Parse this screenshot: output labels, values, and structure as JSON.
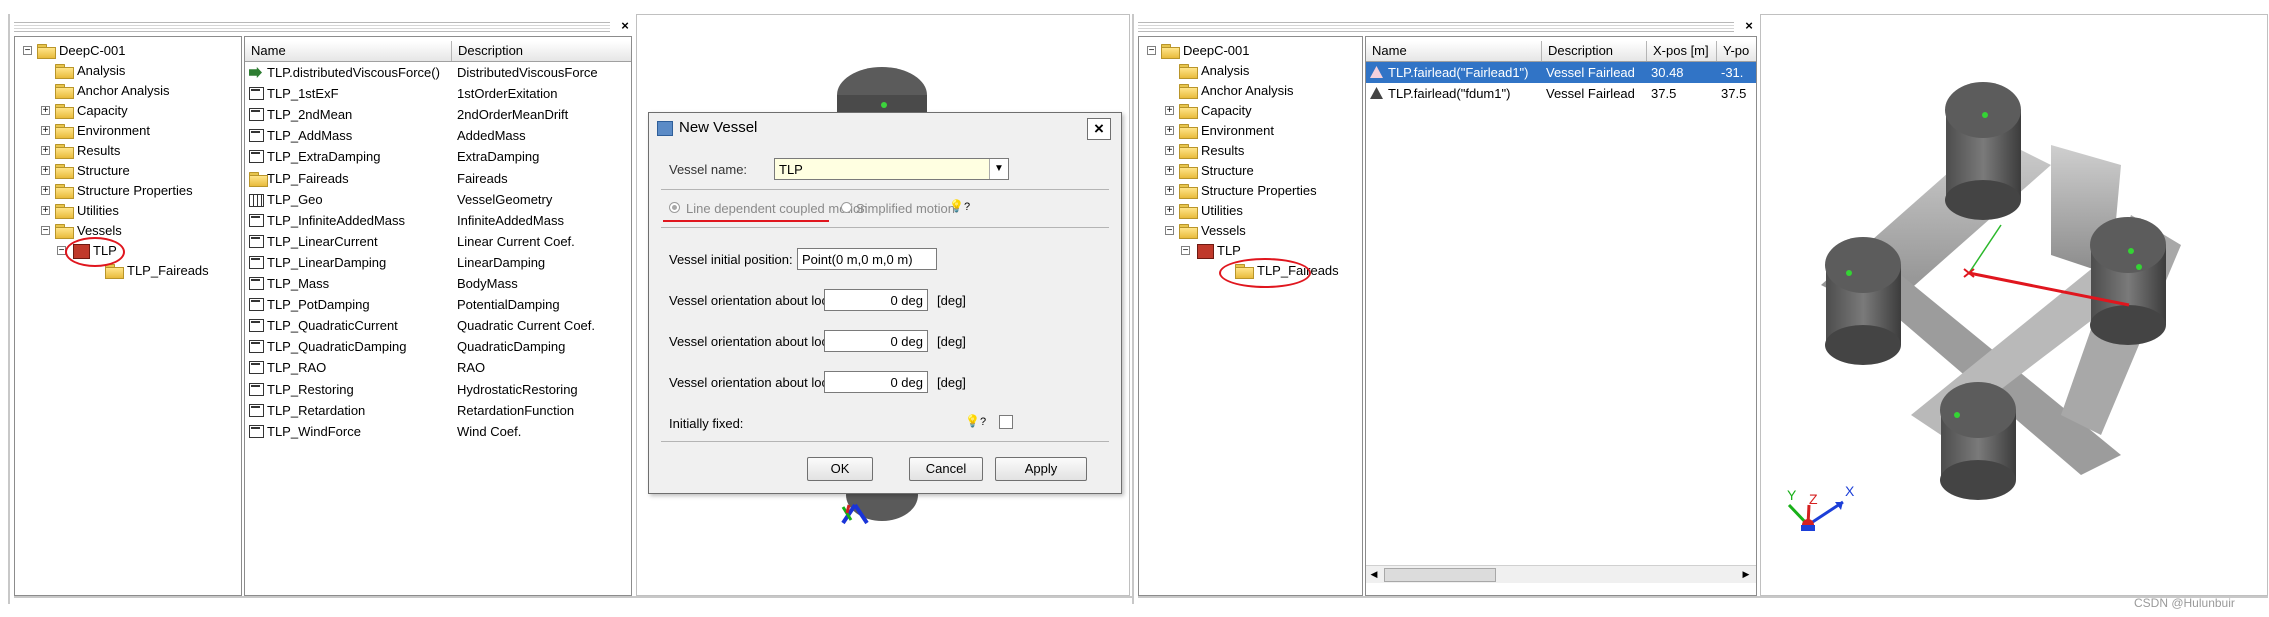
{
  "close_symbol": "×",
  "left": {
    "tree": {
      "root": "DeepC-001",
      "items": [
        {
          "label": "Analysis",
          "expander": ""
        },
        {
          "label": "Anchor Analysis",
          "expander": ""
        },
        {
          "label": "Capacity",
          "expander": "+"
        },
        {
          "label": "Environment",
          "expander": "+"
        },
        {
          "label": "Results",
          "expander": "+"
        },
        {
          "label": "Structure",
          "expander": "+"
        },
        {
          "label": "Structure Properties",
          "expander": "+"
        },
        {
          "label": "Utilities",
          "expander": "+"
        },
        {
          "label": "Vessels",
          "expander": "−"
        }
      ],
      "vessel": "TLP",
      "child": "TLP_Faireads_label",
      "child_label": "TLP_Faireads"
    },
    "list": {
      "headers": [
        "Name",
        "Description"
      ],
      "rows": [
        {
          "name": "TLP.distributedViscousForce()",
          "desc": "DistributedViscousForce",
          "icon": "function-icon"
        },
        {
          "name": "TLP_1stExF",
          "desc": "1stOrderExitation",
          "icon": "table-icon"
        },
        {
          "name": "TLP_2ndMean",
          "desc": "2ndOrderMeanDrift",
          "icon": "table-icon"
        },
        {
          "name": "TLP_AddMass",
          "desc": "AddedMass",
          "icon": "table-icon"
        },
        {
          "name": "TLP_ExtraDamping",
          "desc": "ExtraDamping",
          "icon": "table-icon"
        },
        {
          "name": "TLP_Faireads",
          "desc": "Faireads",
          "icon": "folder-icon"
        },
        {
          "name": "TLP_Geo",
          "desc": "VesselGeometry",
          "icon": "geometry-icon"
        },
        {
          "name": "TLP_InfiniteAddedMass",
          "desc": "InfiniteAddedMass",
          "icon": "table-icon"
        },
        {
          "name": "TLP_LinearCurrent",
          "desc": "Linear Current Coef.",
          "icon": "table-icon"
        },
        {
          "name": "TLP_LinearDamping",
          "desc": "LinearDamping",
          "icon": "table-icon"
        },
        {
          "name": "TLP_Mass",
          "desc": "BodyMass",
          "icon": "table-icon"
        },
        {
          "name": "TLP_PotDamping",
          "desc": "PotentialDamping",
          "icon": "table-icon"
        },
        {
          "name": "TLP_QuadraticCurrent",
          "desc": "Quadratic Current Coef.",
          "icon": "table-icon"
        },
        {
          "name": "TLP_QuadraticDamping",
          "desc": "QuadraticDamping",
          "icon": "table-icon"
        },
        {
          "name": "TLP_RAO",
          "desc": "RAO",
          "icon": "table-icon"
        },
        {
          "name": "TLP_Restoring",
          "desc": "HydrostaticRestoring",
          "icon": "table-icon"
        },
        {
          "name": "TLP_Retardation",
          "desc": "RetardationFunction",
          "icon": "table-icon"
        },
        {
          "name": "TLP_WindForce",
          "desc": "Wind Coef.",
          "icon": "table-icon"
        }
      ]
    }
  },
  "dialog": {
    "title": "New Vessel",
    "vessel_name_label": "Vessel name:",
    "vessel_name_value": "TLP",
    "radio_line": "Line dependent coupled motion",
    "radio_simple": "Simplified motion",
    "help_icon": "?",
    "position_label": "Vessel initial position:",
    "position_value": "Point(0 m,0 m,0 m)",
    "rot_x_label": "Vessel orientation about local X axis:",
    "rot_x_value": "0 deg",
    "rot_y_label": "Vessel orientation about local Y axis:",
    "rot_y_value": "0 deg",
    "rot_z_label": "Vessel orientation about local Z axis:",
    "rot_z_value": "0 deg",
    "unit": "[deg]",
    "fixed_label": "Initially fixed:",
    "ok": "OK",
    "cancel": "Cancel",
    "apply": "Apply"
  },
  "right": {
    "tree": {
      "root": "DeepC-001",
      "items": [
        {
          "label": "Analysis",
          "expander": ""
        },
        {
          "label": "Anchor Analysis",
          "expander": ""
        },
        {
          "label": "Capacity",
          "expander": "+"
        },
        {
          "label": "Environment",
          "expander": "+"
        },
        {
          "label": "Results",
          "expander": "+"
        },
        {
          "label": "Structure",
          "expander": "+"
        },
        {
          "label": "Structure Properties",
          "expander": "+"
        },
        {
          "label": "Utilities",
          "expander": "+"
        },
        {
          "label": "Vessels",
          "expander": "−"
        }
      ],
      "vessel": "TLP",
      "child_label": "TLP_Faireads"
    },
    "list": {
      "headers": [
        "Name",
        "Description",
        "X-pos [m]",
        "Y-po"
      ],
      "rows": [
        {
          "name": "TLP.fairlead(\"Fairlead1\")",
          "desc": "Vessel Fairlead",
          "x": "30.48",
          "y": "-31."
        },
        {
          "name": "TLP.fairlead(\"fdum1\")",
          "desc": "Vessel Fairlead",
          "x": "37.5",
          "y": "37.5"
        }
      ]
    },
    "axes": {
      "x": "X",
      "y": "Y",
      "z": "Z"
    }
  },
  "watermark": "CSDN @Hulunbuir",
  "colors": {
    "selection": "#3174c6",
    "annotation": "#e0161e",
    "folder": "#f2cf5b"
  }
}
